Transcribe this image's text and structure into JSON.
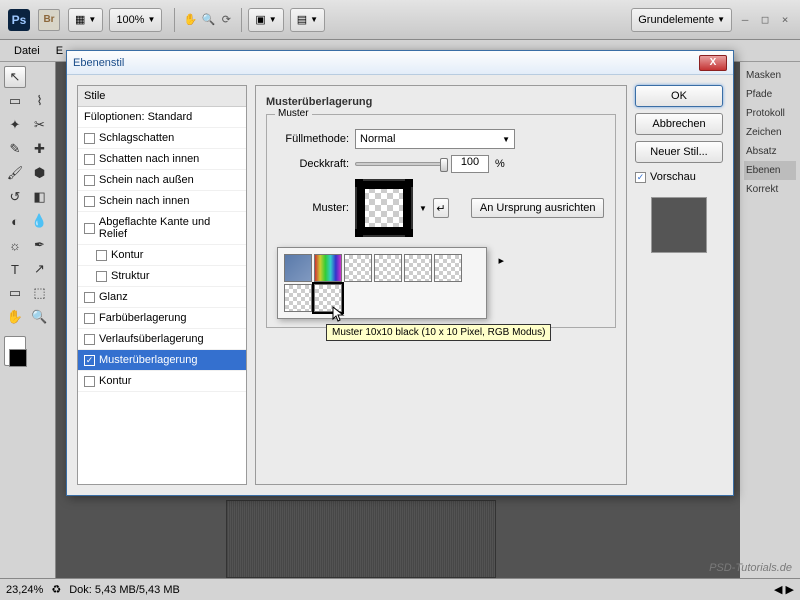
{
  "topbar": {
    "zoom": "100%",
    "workspace": "Grundelemente"
  },
  "menubar": {
    "file": "Datei",
    "edit": "E"
  },
  "dialog": {
    "title": "Ebenenstil",
    "styles_header": "Stile",
    "fill_options": "Füloptionen: Standard",
    "items": [
      "Schlagschatten",
      "Schatten nach innen",
      "Schein nach außen",
      "Schein nach innen",
      "Abgeflachte Kante und Relief",
      "Kontur",
      "Struktur",
      "Glanz",
      "Farbüberlagerung",
      "Verlaufsüberlagerung",
      "Musterüberlagerung",
      "Kontur"
    ],
    "section_title": "Musterüberlagerung",
    "fieldset_legend": "Muster",
    "blend_label": "Füllmethode:",
    "blend_value": "Normal",
    "opacity_label": "Deckkraft:",
    "opacity_value": "100",
    "opacity_unit": "%",
    "pattern_label": "Muster:",
    "snap_btn": "An Ursprung ausrichten",
    "tooltip": "Muster 10x10 black (10 x 10 Pixel, RGB Modus)",
    "ok": "OK",
    "cancel": "Abbrechen",
    "new_style": "Neuer Stil...",
    "preview": "Vorschau"
  },
  "panels": [
    "Masken",
    "Pfade",
    "Protokoll",
    "Zeichen",
    "Absatz",
    "Ebenen",
    "Korrekt"
  ],
  "status": {
    "zoom": "23,24%",
    "doc": "Dok: 5,43 MB/5,43 MB"
  },
  "watermark": "PSD-Tutorials.de"
}
